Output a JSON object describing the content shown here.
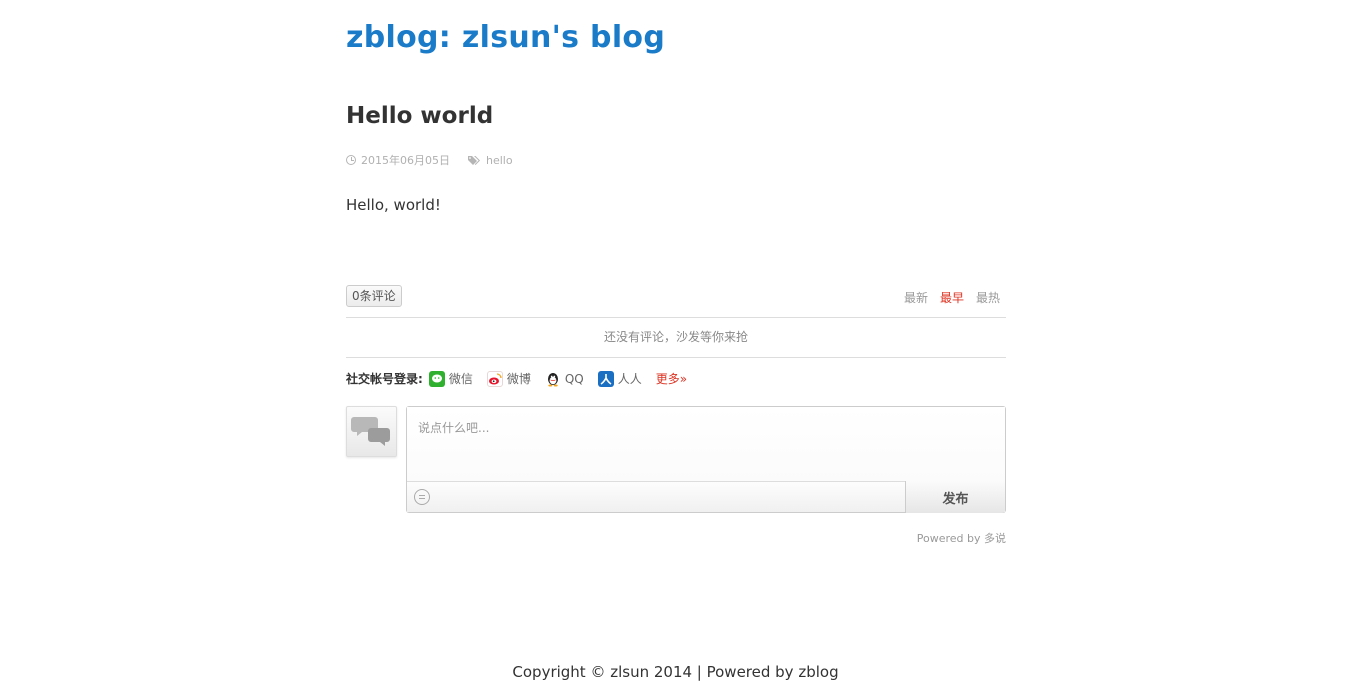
{
  "site": {
    "title": "zblog: zlsun's blog"
  },
  "post": {
    "title": "Hello world",
    "date": "2015年06月05日",
    "tag": "hello",
    "body": "Hello, world!"
  },
  "comments": {
    "count_label": "0条评论",
    "sort": [
      "最新",
      "最早",
      "最热"
    ],
    "sort_active": "最早",
    "empty_text": "还没有评论，沙发等你来抢",
    "social_label": "社交帐号登录:",
    "social": [
      "微信",
      "微博",
      "QQ",
      "人人"
    ],
    "more_label": "更多»",
    "placeholder": "说点什么吧...",
    "submit_label": "发布",
    "powered_prefix": "Powered by ",
    "powered_link": "多说"
  },
  "footer": {
    "text": "Copyright © zlsun 2014 | Powered by zblog"
  },
  "colors": {
    "link": "#1a7bc9",
    "active": "#dd3322",
    "text": "#333333"
  }
}
